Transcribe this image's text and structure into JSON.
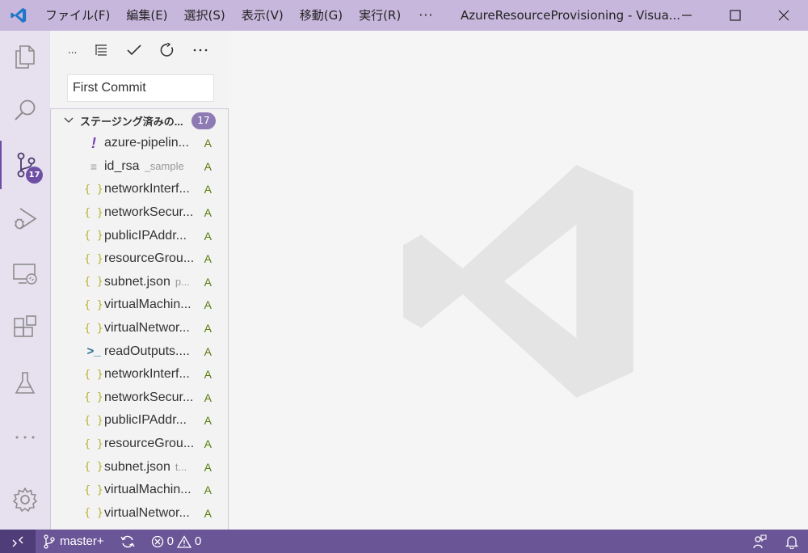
{
  "titlebar": {
    "menu": [
      "ファイル(F)",
      "編集(E)",
      "選択(S)",
      "表示(V)",
      "移動(G)",
      "実行(R)"
    ],
    "more": "···",
    "window_title": "AzureResourceProvisioning - Visua..."
  },
  "activity": {
    "scm_badge": "17"
  },
  "scm": {
    "toolbar_ellipsis": "...",
    "commit_message": "First Commit",
    "group_label": "ステージング済みの...",
    "group_count": "17",
    "files": [
      {
        "name": "azure-pipelin...",
        "desc": "",
        "icon": "exclamation-icon",
        "status": "A"
      },
      {
        "name": "id_rsa",
        "desc": "_sample",
        "icon": "text-file-icon",
        "status": "A"
      },
      {
        "name": "networkInterf...",
        "desc": "",
        "icon": "json-icon",
        "status": "A"
      },
      {
        "name": "networkSecur...",
        "desc": "",
        "icon": "json-icon",
        "status": "A"
      },
      {
        "name": "publicIPAddr...",
        "desc": "",
        "icon": "json-icon",
        "status": "A"
      },
      {
        "name": "resourceGrou...",
        "desc": "",
        "icon": "json-icon",
        "status": "A"
      },
      {
        "name": "subnet.json",
        "desc": "p...",
        "icon": "json-icon",
        "status": "A"
      },
      {
        "name": "virtualMachin...",
        "desc": "",
        "icon": "json-icon",
        "status": "A"
      },
      {
        "name": "virtualNetwor...",
        "desc": "",
        "icon": "json-icon",
        "status": "A"
      },
      {
        "name": "readOutputs....",
        "desc": "",
        "icon": "shell-icon",
        "status": "A"
      },
      {
        "name": "networkInterf...",
        "desc": "",
        "icon": "json-icon",
        "status": "A"
      },
      {
        "name": "networkSecur...",
        "desc": "",
        "icon": "json-icon",
        "status": "A"
      },
      {
        "name": "publicIPAddr...",
        "desc": "",
        "icon": "json-icon",
        "status": "A"
      },
      {
        "name": "resourceGrou...",
        "desc": "",
        "icon": "json-icon",
        "status": "A"
      },
      {
        "name": "subnet.json",
        "desc": "t...",
        "icon": "json-icon",
        "status": "A"
      },
      {
        "name": "virtualMachin...",
        "desc": "",
        "icon": "json-icon",
        "status": "A"
      },
      {
        "name": "virtualNetwor...",
        "desc": "",
        "icon": "json-icon",
        "status": "A"
      }
    ]
  },
  "statusbar": {
    "branch": "master+",
    "errors": "0",
    "warnings": "0"
  },
  "colors": {
    "titlebar": "#c8b7dc",
    "activitybar": "#e6e0ef",
    "statusbar": "#6a5597",
    "accent": "#6e4fa5"
  }
}
